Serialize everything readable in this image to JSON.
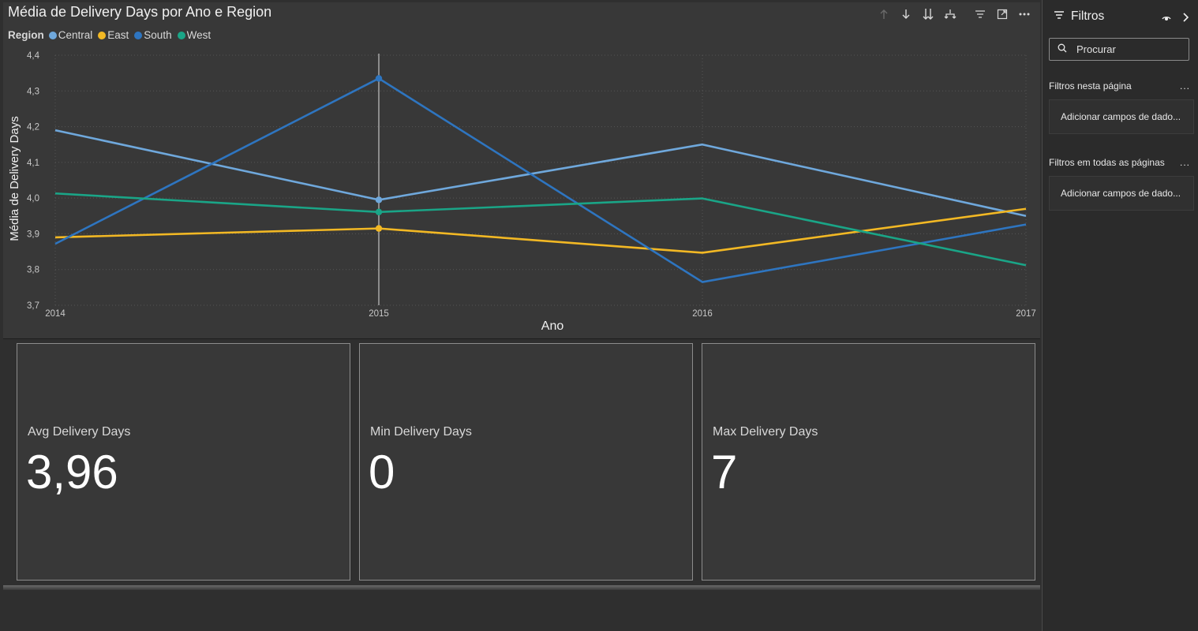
{
  "visual": {
    "title": "Média de Delivery Days por Ano e Region",
    "legend_title": "Region"
  },
  "chart_data": {
    "type": "line",
    "title": "Média de Delivery Days por Ano e Region",
    "xlabel": "Ano",
    "ylabel": "Média de Delivery Days",
    "x": [
      "2014",
      "2015",
      "2016",
      "2017"
    ],
    "yticks": [
      "3,7",
      "3,8",
      "3,9",
      "4,0",
      "4,1",
      "4,2",
      "4,3",
      "4,4"
    ],
    "ylim": [
      3.7,
      4.4
    ],
    "grid": true,
    "legend_position": "top-left",
    "highlighted_x": "2015",
    "series": [
      {
        "name": "Central",
        "color": "#6fa8dc",
        "values": [
          4.19,
          3.995,
          4.15,
          3.95
        ]
      },
      {
        "name": "East",
        "color": "#f2b824",
        "values": [
          3.89,
          3.915,
          3.847,
          3.97
        ]
      },
      {
        "name": "South",
        "color": "#2e75c0",
        "values": [
          3.872,
          4.335,
          3.765,
          3.926
        ]
      },
      {
        "name": "West",
        "color": "#1aa587",
        "values": [
          4.013,
          3.961,
          3.999,
          3.812
        ]
      }
    ]
  },
  "cards": [
    {
      "label": "Avg Delivery Days",
      "value": "3,96"
    },
    {
      "label": "Min Delivery Days",
      "value": "0"
    },
    {
      "label": "Max Delivery Days",
      "value": "7"
    }
  ],
  "filters": {
    "title": "Filtros",
    "search_placeholder": "Procurar",
    "page_section": "Filtros nesta página",
    "page_add": "Adicionar campos de dado...",
    "all_section": "Filtros em todas as páginas",
    "all_add": "Adicionar campos de dado...",
    "more": "..."
  }
}
